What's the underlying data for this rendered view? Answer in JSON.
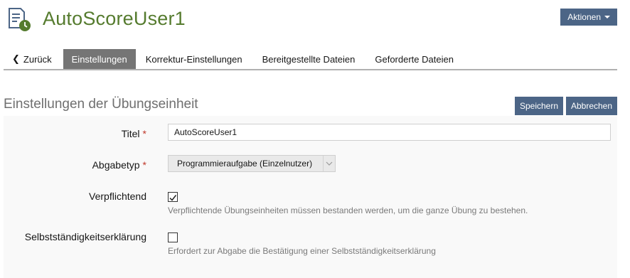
{
  "header": {
    "title": "AutoScoreUser1",
    "icon": "exercise-assignment-icon",
    "actions_label": "Aktionen"
  },
  "tabs": [
    {
      "label": "Zurück",
      "icon": "chevron-left-icon"
    },
    {
      "label": "Einstellungen",
      "active": true
    },
    {
      "label": "Korrektur-Einstellungen"
    },
    {
      "label": "Bereitgestellte Dateien"
    },
    {
      "label": "Geforderte Dateien"
    }
  ],
  "section": {
    "title": "Einstellungen der Übungseinheit",
    "save_label": "Speichern",
    "cancel_label": "Abbrechen"
  },
  "form": {
    "title_label": "Titel",
    "title_value": "AutoScoreUser1",
    "required_marker": "*",
    "type_label": "Abgabetyp",
    "type_value": "Programmieraufgabe (Einzelnutzer)",
    "mandatory_label": "Verpflichtend",
    "mandatory_checked": true,
    "mandatory_help": "Verpflichtende Übungseinheiten müssen bestanden werden, um die ganze Übung zu bestehen.",
    "declaration_label": "Selbstständigkeitserklärung",
    "declaration_checked": false,
    "declaration_help": "Erfordert zur Abgabe die Bestätigung einer Selbstständigkeitserklärung"
  },
  "colors": {
    "title_green": "#557b2e",
    "button_blue": "#4c6586",
    "active_tab": "#757575",
    "required_red": "#c0392b"
  }
}
